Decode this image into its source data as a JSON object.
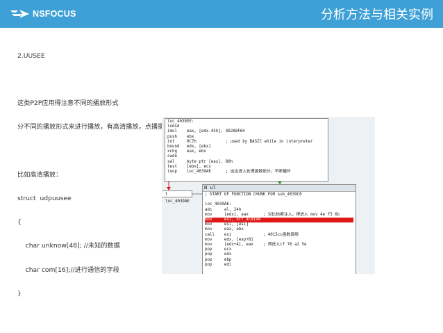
{
  "header": {
    "logo_text": "NSFOCUS",
    "title": "分析方法与相关实例",
    "accent_color": "#3ea0d6"
  },
  "content": {
    "lines": [
      "2.UUSEE",
      "",
      "这类P2P应用得注意不同的播放形式",
      "分不同的播放形式来进行播放，有高清播放，点播播放，直播播放，各种播放形式对应的协议是不一样的",
      "",
      "比如高清播放：",
      "struct  udpuusee",
      "{",
      "    char unknow[48]; //未知的数据",
      "    char com[16];//进行通信的字段",
      "}"
    ]
  },
  "screenshot": {
    "block1_lines": [
      "loc_4039EE:",
      "lodsd",
      "imul    eax, [edx-45h], 4D2A8F6h",
      "push    ebx",
      "int     0C7h            ; used by BASIC while in interpreter",
      "bound   edx, [ebx]",
      "xchg    eax, ebx",
      "cwde",
      "sal     byte ptr [eax], 80h",
      "test    [ebx], ecx",
      "loop    loc_4039AE      ; 这边进入处理函数部分，不断播环"
    ],
    "block3_label": "t loc_4039AE",
    "block2_title": "N ul",
    "block2_lines": [
      "; START OF FUNCTION CHUNK FOR sub_4039C0",
      "",
      "loc_4039AE:",
      "adc     al, 24h",
      "mov     [edx], eax      ; 对比检索注入，得进入 mov 4e f5 6b",
      "mov     esi, off_4C0194",
      "mov     esi, [esi]",
      "mov     eax, ebx",
      "call    esi             ; 4015cc函数调用",
      "mov     edx, [esp+8]",
      "mov     [edx+4], eax    ; 得进入cf 76 a2 5e",
      "pop     ecx",
      "pop     edx",
      "pop     ebp",
      "pop     edi"
    ],
    "highlight_row_index": 4,
    "highlight_color": "#e01818"
  }
}
